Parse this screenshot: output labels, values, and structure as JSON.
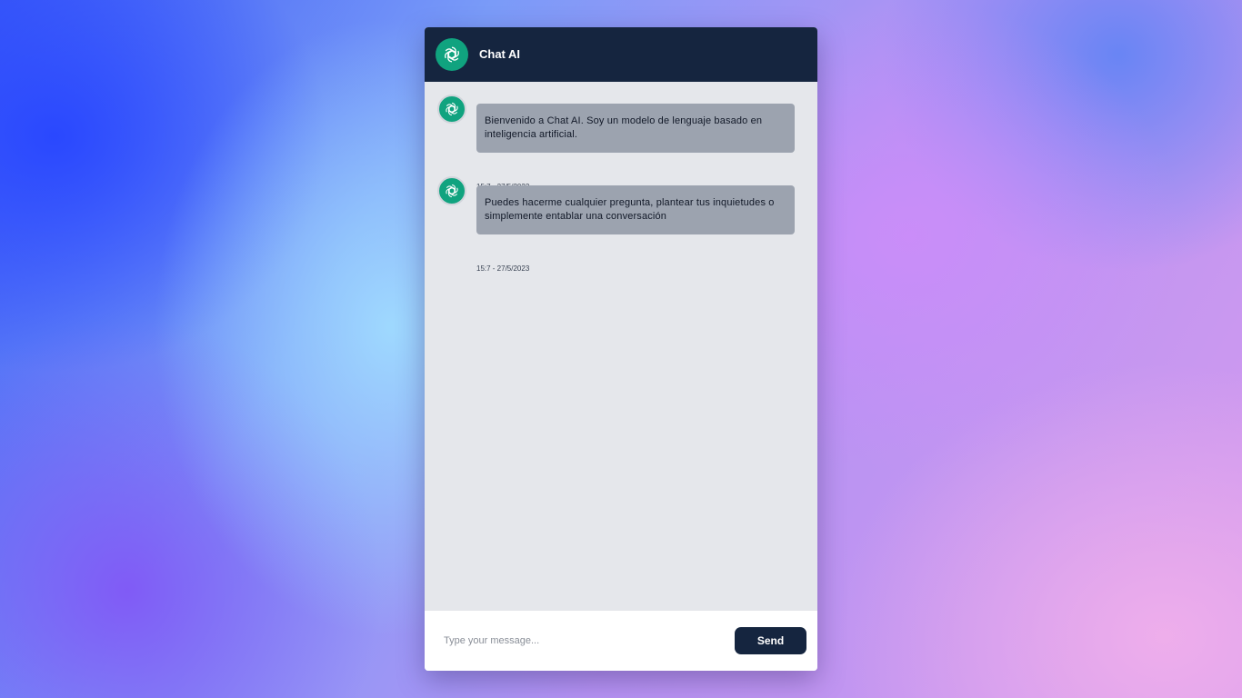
{
  "header": {
    "title": "Chat AI",
    "avatar_icon": "openai-logo-icon"
  },
  "messages": [
    {
      "sender": "bot",
      "avatar_icon": "openai-logo-icon",
      "text": "Bienvenido a Chat AI. Soy un modelo de lenguaje basado en inteligencia artificial.",
      "time": "15:7 - 27/5/2023"
    },
    {
      "sender": "bot",
      "avatar_icon": "openai-logo-icon",
      "text": "Puedes hacerme cualquier pregunta, plantear tus inquietudes o simplemente entablar una conversación",
      "time": "15:7 - 27/5/2023"
    }
  ],
  "composer": {
    "placeholder": "Type your message...",
    "value": "",
    "send_label": "Send"
  },
  "colors": {
    "header_bg": "#15253f",
    "avatar_bg": "#10a37f",
    "bubble_bg": "#9ca3af",
    "chat_bg": "#e5e7eb",
    "send_bg": "#15253f"
  }
}
